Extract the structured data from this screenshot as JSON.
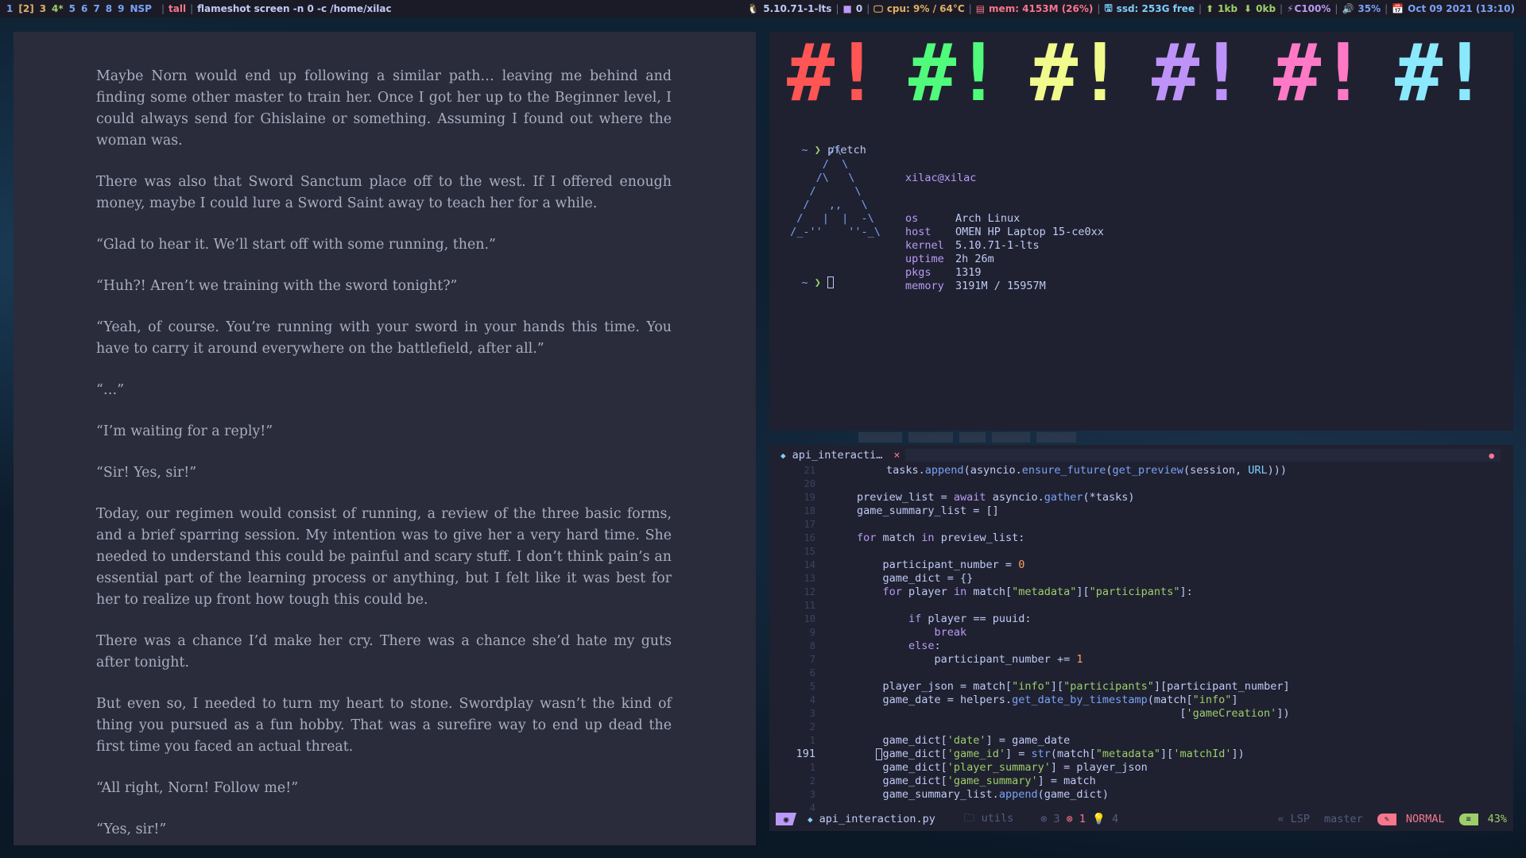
{
  "topbar": {
    "workspaces": [
      "1",
      "[2]",
      "3",
      "4*",
      "5",
      "6",
      "7",
      "8",
      "9",
      "NSP"
    ],
    "workspace_colors": [
      "#7aa2f7",
      "#e0af68",
      "#e0af68",
      "#9ece6a",
      "#7aa2f7",
      "#7aa2f7",
      "#7aa2f7",
      "#7aa2f7",
      "#7aa2f7",
      "#7aa2f7"
    ],
    "layout": "tall",
    "window_title": "flameshot screen -n 0 -c /home/xilac",
    "kernel": "5.10.71-1-lts",
    "updates": "0",
    "cpu": "cpu: 9% / 64°C",
    "mem": "mem: 4153M (26%)",
    "ssd": "ssd: 253G free",
    "net_up": "1kb",
    "net_down": "0kb",
    "battery": "C100%",
    "volume": "35%",
    "datetime": "Oct 09 2021 (13:10)",
    "icons": {
      "kernel": "tux-icon",
      "updates": "package-icon",
      "cpu": "monitor-icon",
      "mem": "memory-icon",
      "ssd": "disk-icon",
      "up": "upload-icon",
      "down": "download-icon",
      "battery": "battery-icon",
      "volume": "speaker-icon",
      "calendar": "calendar-icon"
    },
    "colors": {
      "kernel": "#c0caf5",
      "updates": "#c0caf5",
      "cpu": "#e0af68",
      "mem": "#f7768e",
      "ssd": "#7dcfff",
      "net": "#9ece6a",
      "battery": "#bb9af7",
      "volume": "#7aa2f7",
      "date": "#7aa2f7"
    }
  },
  "reader": {
    "paragraphs": [
      "Maybe Norn would end up following a similar path… leaving me behind and finding some other master to train her. Once I got her up to the Beginner level, I could always send for Ghislaine or something. Assuming I found out where the woman was.",
      "There was also that Sword Sanctum place off to the west. If I offered enough money, maybe I could lure a Sword Saint away to teach her for a while.",
      "“Glad to hear it. We’ll start off with some running, then.”",
      "“Huh?! Aren’t we training with the sword tonight?”",
      "“Yeah, of course. You’re running with your sword in your hands this time. You have to carry it around everywhere on the battlefield, after all.”",
      "“…”",
      "“I’m waiting for a reply!”",
      "“Sir! Yes, sir!”",
      "Today, our regimen would consist of running, a review of the three basic forms, and a brief sparring session. My intention was to give her a very hard time. She needed to understand this could be painful and scary stuff. I don’t think pain’s an essential part of the learning process or anything, but I felt like it was best for her to realize up front how tough this could be.",
      "There was a chance I’d make her cry. There was a chance she’d hate my guts after tonight.",
      "But even so, I needed to turn my heart to stone. Swordplay wasn’t the kind of thing you pursued as a fun hobby. That was a surefire way to end up dead the first time you faced an actual threat.",
      "“All right, Norn! Follow me!”",
      "“Yes, sir!”"
    ]
  },
  "terminal": {
    "colorbar_glyph": "#!",
    "colorbar_colors": [
      "#ff5555",
      "#50fa7b",
      "#f1fa8c",
      "#bd93f9",
      "#ff79c6",
      "#8be9fd"
    ],
    "prompt_tilde": "~",
    "prompt_arrow": "❯",
    "command": "pfetch",
    "ascii_art": "       /\\\n      /  \\\n     /\\   \\\n    /      \\\n   /   ,,   \\\n  /   |  |  -\\\n /_-''    ''-_\\",
    "user_host": "xilac@xilac",
    "info": [
      {
        "key": "os",
        "value": "Arch Linux"
      },
      {
        "key": "host",
        "value": "OMEN HP Laptop 15-ce0xx"
      },
      {
        "key": "kernel",
        "value": "5.10.71-1-lts"
      },
      {
        "key": "uptime",
        "value": "2h 26m"
      },
      {
        "key": "pkgs",
        "value": "1319"
      },
      {
        "key": "memory",
        "value": "3191M / 15957M"
      }
    ]
  },
  "editor": {
    "tab_label": "api_interacti…",
    "tab_close": "×",
    "filename": "api_interaction.py",
    "directory": "utils",
    "diag_warn": "3",
    "diag_err": "1",
    "diag_hint": "4",
    "lsp": "LSP",
    "branch": "master",
    "mode": "NORMAL",
    "percent": "43%",
    "line_numbers": [
      "21",
      "20",
      "19",
      "18",
      "17",
      "16",
      "15",
      "14",
      "13",
      "12",
      "11",
      "10",
      "9",
      "8",
      "7",
      "6",
      "5",
      "4",
      "3",
      "2",
      "1",
      "191",
      "1",
      "2",
      "3",
      "4"
    ]
  }
}
